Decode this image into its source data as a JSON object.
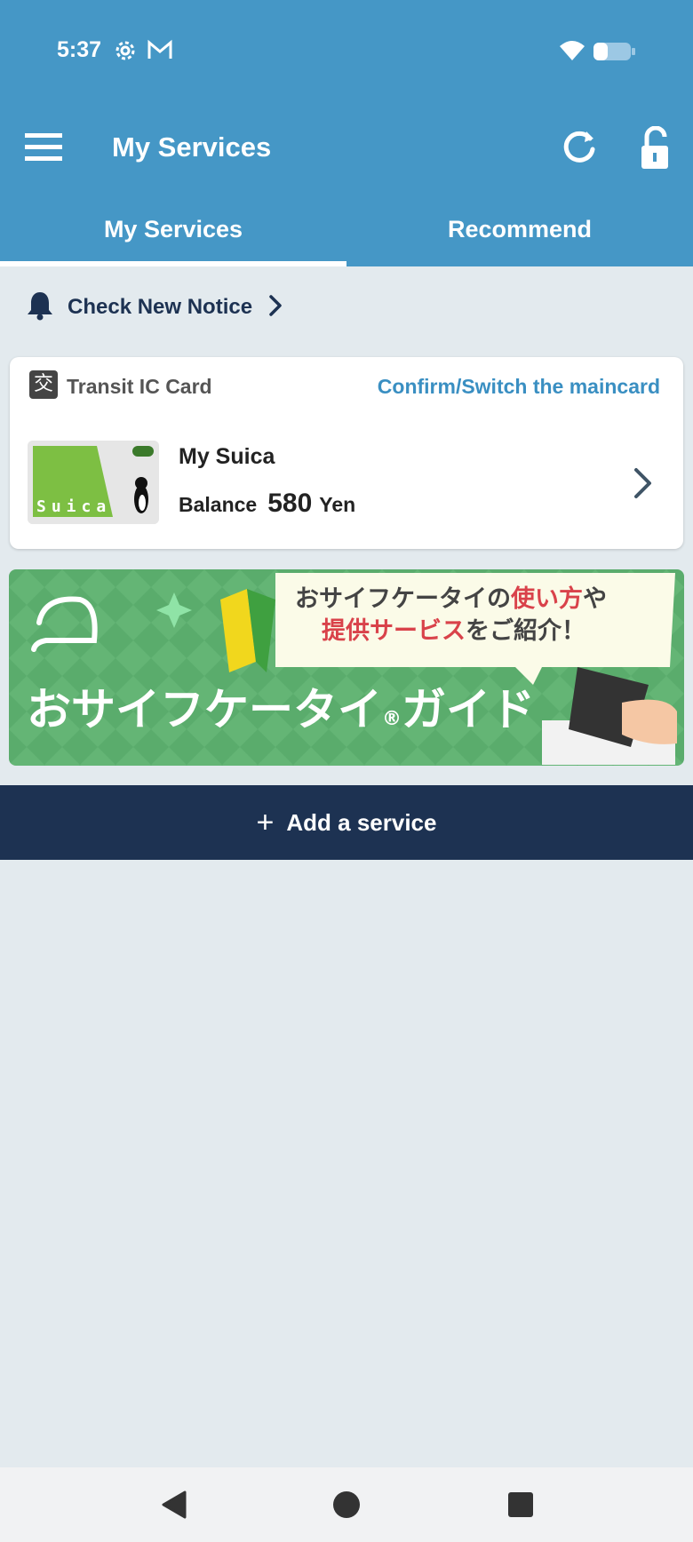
{
  "status_bar": {
    "time": "5:37",
    "icons": [
      "gear-icon",
      "gmail-icon",
      "wifi-icon",
      "battery-icon"
    ]
  },
  "toolbar": {
    "title": "My Services",
    "icons": [
      "menu-icon",
      "refresh-icon",
      "lock-icon"
    ]
  },
  "tabs": [
    {
      "label": "My Services",
      "selected": true
    },
    {
      "label": "Recommend",
      "selected": false
    }
  ],
  "notice": {
    "label": "Check New Notice",
    "icon": "bell-icon"
  },
  "transit_card": {
    "header_icon": "交",
    "header_label": "Transit IC Card",
    "switch_link": "Confirm/Switch the maincard",
    "card_name": "My Suica",
    "balance_label": "Balance",
    "balance_value": "580",
    "balance_unit": "Yen",
    "thumb_text": "Suica"
  },
  "banner": {
    "line1_a": "おサイフケータイの",
    "line1_highlight": "使い方",
    "line1_b": "や",
    "line2_highlight": "提供サービス",
    "line2_b": "をご紹介！",
    "title_a": "おサイフケータイ",
    "title_reg": "®",
    "title_b": "ガイド"
  },
  "add_service": {
    "label": "Add a service"
  },
  "colors": {
    "header": "#4597c6",
    "background": "#e3eaee",
    "dark_navy": "#1d3252",
    "link": "#3a8fc2",
    "banner_green": "#5aac6c"
  }
}
